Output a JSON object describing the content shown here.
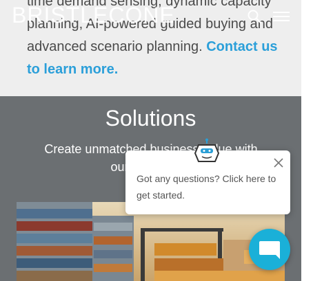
{
  "header": {
    "logo_text": "BRISTLECONE",
    "search_icon": "search-icon",
    "menu_icon": "hamburger-menu-icon"
  },
  "intro": {
    "line1": "time demand sensing, dynamic capacity",
    "line2": "planning, AI-powered guided buying and",
    "line3": "advanced scenario planning. ",
    "link_part1": "Contact us",
    "link_part2": "to learn more."
  },
  "solutions": {
    "title": "Solutions",
    "subtitle_line1": "Create unmatched business value with",
    "subtitle_line2": "our transforma"
  },
  "chat": {
    "message": "Got any questions? Click here to get started.",
    "close_icon": "close-icon",
    "bot_icon": "chatbot-icon",
    "launcher_icon": "chat-bubble-icon"
  },
  "colors": {
    "link": "#2b9fd9",
    "dark_band": "#6b6f72",
    "launcher": "#1ab0d8"
  }
}
